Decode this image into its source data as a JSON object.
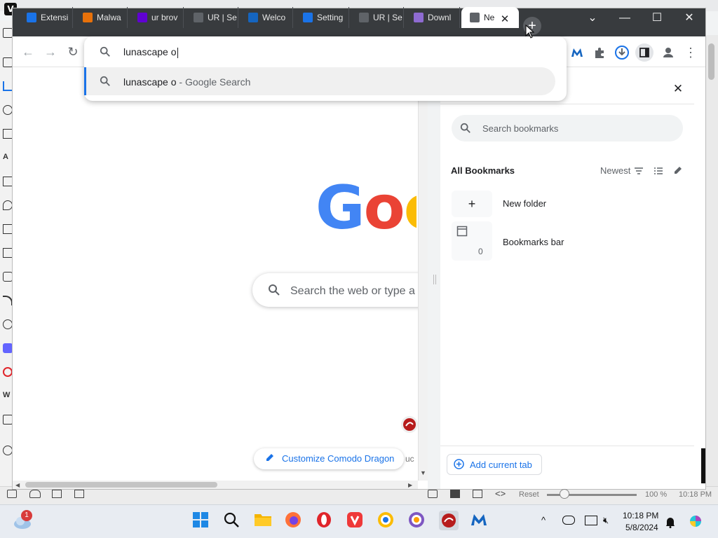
{
  "tabs": [
    {
      "label": "Extensi",
      "icon": "puzzle-icon",
      "color": "#1a73e8"
    },
    {
      "label": "Malwa",
      "icon": "photos-icon",
      "color": "#e8710a"
    },
    {
      "label": "ur brov",
      "icon": "yahoo-icon",
      "color": "#6001d2"
    },
    {
      "label": "UR | Se",
      "icon": "globe-icon",
      "color": "#5f6368"
    },
    {
      "label": "Welco",
      "icon": "malwarebytes-icon",
      "color": "#1565c0"
    },
    {
      "label": "Setting",
      "icon": "gear-icon",
      "color": "#1a73e8"
    },
    {
      "label": "UR | Se",
      "icon": "globe-icon",
      "color": "#5f6368"
    },
    {
      "label": "Downl",
      "icon": "download-site-icon",
      "color": "#8e6bd1"
    },
    {
      "label": "Ne",
      "icon": "chrome-icon",
      "color": "#5f6368"
    }
  ],
  "omnibox": {
    "typed": "lunascape o",
    "suggestion_main": "lunascape o",
    "suggestion_sub": " - Google Search"
  },
  "newtab_page": {
    "logo": "Goo",
    "search_placeholder": "Search the web or type a",
    "customize_label": "Customize Comodo Dragon",
    "cut_text": "uc"
  },
  "bookmarks_panel": {
    "search_placeholder": "Search bookmarks",
    "heading": "All Bookmarks",
    "sort_label": "Newest",
    "new_folder_label": "New folder",
    "bookmarks_bar_label": "Bookmarks bar",
    "bookmarks_bar_count": "0",
    "add_current_tab_label": "Add current tab"
  },
  "vivaldi_status": {
    "reset": "Reset",
    "zoom": "100 %",
    "time": "10:18 PM"
  },
  "taskbar": {
    "time": "10:18 PM",
    "date": "5/8/2024",
    "weather_badge": "1"
  },
  "colors": {
    "accent": "#1a73e8",
    "tabstrip": "#383b3e",
    "google_blue": "#4285f4",
    "google_red": "#ea4335",
    "google_yellow": "#fbbc05"
  }
}
